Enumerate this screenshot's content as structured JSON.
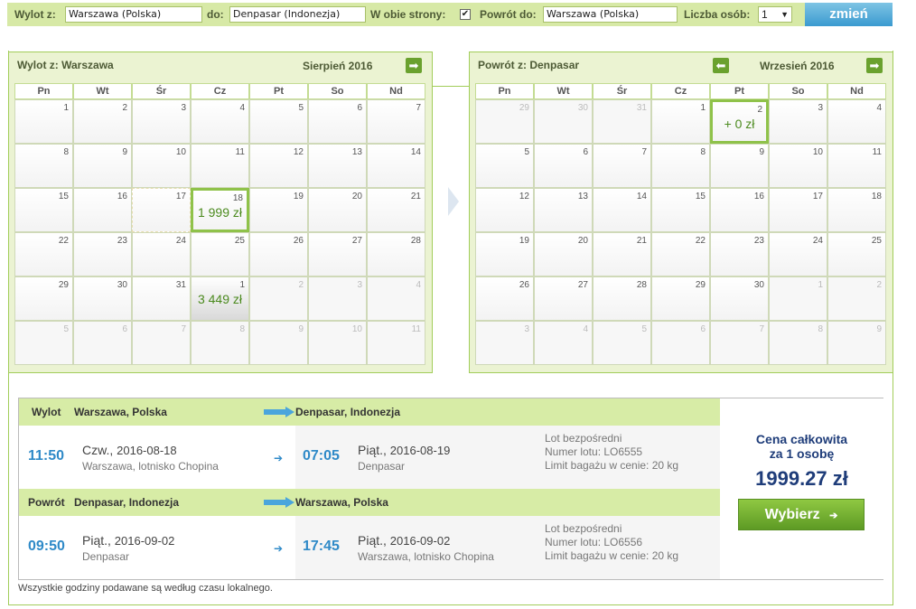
{
  "search": {
    "from_label": "Wylot z:",
    "from_value": "Warszawa (Polska)",
    "to_label": "do:",
    "to_value": "Denpasar (Indonezja)",
    "roundtrip_label": "W obie strony:",
    "roundtrip_check": "✔",
    "return_label": "Powrót do:",
    "return_value": "Warszawa (Polska)",
    "persons_label": "Liczba osób:",
    "persons_value": "1",
    "submit_label": "zmień"
  },
  "cal_out": {
    "title_prefix": "Wylot z:",
    "title_city": "Warszawa",
    "month": "Sierpień 2016",
    "days_of_week": [
      "Pn",
      "Wt",
      "Śr",
      "Cz",
      "Pt",
      "So",
      "Nd"
    ],
    "weeks": [
      [
        "1",
        "2",
        "3",
        "4",
        "5",
        "6",
        "7"
      ],
      [
        "8",
        "9",
        "10",
        "11",
        "12",
        "13",
        "14"
      ],
      [
        "15",
        "16",
        "17",
        "18",
        "19",
        "20",
        "21"
      ],
      [
        "22",
        "23",
        "24",
        "25",
        "26",
        "27",
        "28"
      ],
      [
        "29",
        "30",
        "31",
        "1",
        "2",
        "3",
        "4"
      ],
      [
        "5",
        "6",
        "7",
        "8",
        "9",
        "10",
        "11"
      ]
    ],
    "price_18": "1 999 zł",
    "price_sep1": "3 449 zł"
  },
  "cal_ret": {
    "title_prefix": "Powrót z:",
    "title_city": "Denpasar",
    "month": "Wrzesień 2016",
    "days_of_week": [
      "Pn",
      "Wt",
      "Śr",
      "Cz",
      "Pt",
      "So",
      "Nd"
    ],
    "weeks": [
      [
        "29",
        "30",
        "31",
        "1",
        "2",
        "3",
        "4"
      ],
      [
        "5",
        "6",
        "7",
        "8",
        "9",
        "10",
        "11"
      ],
      [
        "12",
        "13",
        "14",
        "15",
        "16",
        "17",
        "18"
      ],
      [
        "19",
        "20",
        "21",
        "22",
        "23",
        "24",
        "25"
      ],
      [
        "26",
        "27",
        "28",
        "29",
        "30",
        "1",
        "2"
      ],
      [
        "3",
        "4",
        "5",
        "6",
        "7",
        "8",
        "9"
      ]
    ],
    "price_2": "+ 0 zł"
  },
  "outbound": {
    "type": "Wylot",
    "from": "Warszawa, Polska",
    "to": "Denpasar, Indonezja",
    "dep_time": "11:50",
    "dep_day": "Czw.,",
    "dep_date": "2016-08-18",
    "dep_place": "Warszawa, lotnisko Chopina",
    "arr_time": "07:05",
    "arr_day": "Piąt.,",
    "arr_date": "2016-08-19",
    "arr_place": "Denpasar",
    "info1": "Lot bezpośredni",
    "info2": "Numer lotu: LO6555",
    "info3": "Limit bagażu w cenie: 20 kg"
  },
  "inbound": {
    "type": "Powrót",
    "from": "Denpasar, Indonezja",
    "to": "Warszawa, Polska",
    "dep_time": "09:50",
    "dep_day": "Piąt.,",
    "dep_date": "2016-09-02",
    "dep_place": "Denpasar",
    "arr_time": "17:45",
    "arr_day": "Piąt.,",
    "arr_date": "2016-09-02",
    "arr_place": "Warszawa, lotnisko Chopina",
    "info1": "Lot bezpośredni",
    "info2": "Numer lotu: LO6556",
    "info3": "Limit bagażu w cenie: 20 kg"
  },
  "price": {
    "label1": "Cena całkowita",
    "label2": "za 1 osobę",
    "total": "1999.27 zł",
    "button": "Wybierz",
    "button_arrow": "➔"
  },
  "footnote": "Wszystkie godziny podawane są według czasu lokalnego.",
  "colors": {
    "accent_green": "#8fc24a",
    "time_blue": "#2f8ac8",
    "price_navy": "#1f3d7a"
  }
}
